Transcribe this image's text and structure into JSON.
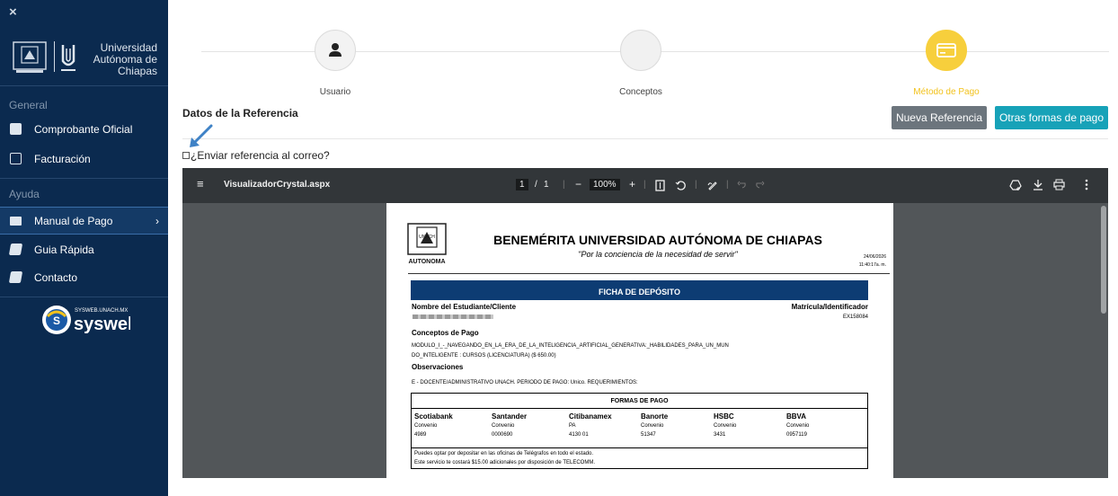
{
  "sidebar": {
    "close": "×",
    "university": "Universidad Autónoma de Chiapas",
    "sections": [
      {
        "title": "General",
        "items": [
          {
            "label": "Comprobante Oficial",
            "icon": "document-icon"
          },
          {
            "label": "Facturación",
            "icon": "invoice-icon"
          }
        ]
      },
      {
        "title": "Ayuda",
        "items": [
          {
            "label": "Manual de Pago",
            "icon": "card-icon",
            "active": true,
            "chevron": "›"
          },
          {
            "label": "Guia Rápida",
            "icon": "book-icon"
          },
          {
            "label": "Contacto",
            "icon": "book-icon"
          }
        ]
      }
    ],
    "brand": "sysweb",
    "brand_url": "SYSWEB.UNACH.MX"
  },
  "stepper": {
    "steps": [
      {
        "label": "Usuario",
        "state": "done",
        "icon": "user-icon"
      },
      {
        "label": "Conceptos",
        "state": "pending",
        "icon": ""
      },
      {
        "label": "Método de Pago",
        "state": "active",
        "icon": "card-icon"
      }
    ],
    "active_color": "#f7cf3c"
  },
  "reference": {
    "title": "Datos de la Referencia",
    "new_button": "Nueva Referencia",
    "other_button": "Otras formas de pago",
    "email_checkbox": "¿Enviar referencia al correo?"
  },
  "viewer": {
    "menu": "≡",
    "filename": "VisualizadorCrystal.aspx",
    "page_current": "1",
    "page_sep": "/",
    "page_total": "1",
    "zoom_minus": "−",
    "zoom": "100%",
    "zoom_plus": "+",
    "toolbar_icons": [
      "fit-page-icon",
      "rotate-icon",
      "annotate-icon",
      "undo-icon",
      "redo-icon"
    ],
    "right_icons": [
      "drive-icon",
      "download-icon",
      "print-icon",
      "more-icon"
    ]
  },
  "document": {
    "crest_text": "UNACH",
    "crest_bottom": "AUTONOMA",
    "title": "BENEMÉRITA UNIVERSIDAD AUTÓNOMA DE CHIAPAS",
    "motto": "\"Por la conciencia de la necesidad de servir\"",
    "date": "24/06/2026",
    "time": "11:40:17a. m.",
    "band": "FICHA DE DEPÓSITO",
    "student_label": "Nombre del Estudiante/Cliente",
    "id_label": "Matrícula/Identificador",
    "id_value": "EX158084",
    "concepts_label": "Conceptos de Pago",
    "concept_line1": "MODULO_I_-_NAVEGANDO_EN_LA_ERA_DE_LA_INTELIGENCIA_ARTIFICIAL_GENERATIVA:_HABILIDADES_PARA_UN_MUN",
    "concept_line2": "DO_INTELIGENTE : CURSOS (LICENCIATURA) ($ 650.00)",
    "observations_label": "Observaciones",
    "observations": "E - DOCENTE/ADMINISTRATIVO UNACH.   PERIODO DE PAGO:  Unico.   REQUERIMIENTOS:",
    "forms_title": "FORMAS DE PAGO",
    "banks": [
      {
        "name": "Scotiabank",
        "type": "Convenio",
        "number": "4989"
      },
      {
        "name": "Santander",
        "type": "Convenio",
        "number": "0000690"
      },
      {
        "name": "Citibanamex",
        "type": "PA",
        "number": "4130 01"
      },
      {
        "name": "Banorte",
        "type": "Convenio",
        "number": "51347"
      },
      {
        "name": "HSBC",
        "type": "Convenio",
        "number": "3431"
      },
      {
        "name": "BBVA",
        "type": "Convenio",
        "number": "0957119"
      }
    ],
    "note1": "Puedes optar por depositar en las oficinas de Telégrafos en todo el estado.",
    "note2": "Este servicio te costará $15.00 adicionales por disposición de TELECOMM."
  }
}
